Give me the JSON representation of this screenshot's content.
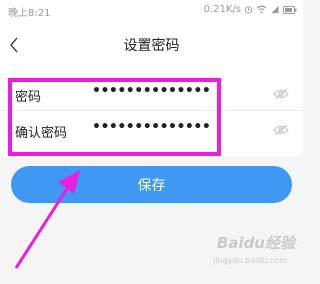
{
  "status_bar": {
    "time": "晚上8:21",
    "speed": "0.21K/s"
  },
  "navbar": {
    "title": "设置密码"
  },
  "form": {
    "password_label": "密码",
    "password_value": "••••••••••••••",
    "confirm_label": "确认密码",
    "confirm_value": "••••••••••••••"
  },
  "actions": {
    "save_label": "保存"
  },
  "watermark": {
    "brand": "Baidu经验",
    "url": "jingyan.baidu.com"
  },
  "colors": {
    "accent": "#3f98f1",
    "highlight": "#e91ee0",
    "background": "#f5f5f5"
  },
  "icons": [
    "chevron-left-icon",
    "eye-icon",
    "wifi-icon",
    "signal-icon",
    "battery-icon",
    "alarm-icon"
  ]
}
